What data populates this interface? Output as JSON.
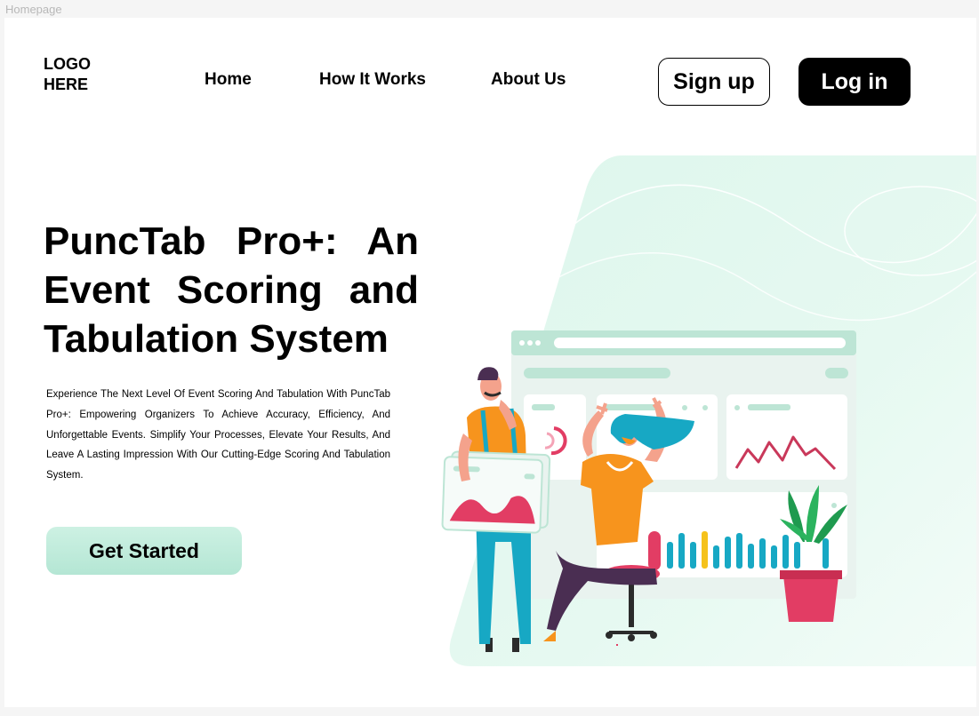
{
  "frame": {
    "label": "Homepage"
  },
  "header": {
    "logo_line1": "LOGO",
    "logo_line2": "HERE",
    "nav": [
      {
        "label": "Home"
      },
      {
        "label": "How It Works"
      },
      {
        "label": "About Us"
      }
    ],
    "signup_label": "Sign up",
    "login_label": "Log in"
  },
  "hero": {
    "title": "PuncTab Pro+: An Event Scoring and Tabulation System",
    "description": "Experience The Next Level Of Event Scoring And Tabulation With PuncTab Pro+: Empowering Organizers To Achieve Accuracy, Efficiency, And Unforgettable Events. Simplify Your Processes, Elevate Your Results, And Leave A Lasting Impression With Our Cutting-Edge Scoring And Tabulation System.",
    "cta_label": "Get Started"
  },
  "colors": {
    "accent_mint": "#c6eedf",
    "illustration_red": "#e23d64",
    "illustration_orange": "#f7941d",
    "illustration_teal": "#17a8c4",
    "illustration_yellow": "#f5c21b"
  }
}
